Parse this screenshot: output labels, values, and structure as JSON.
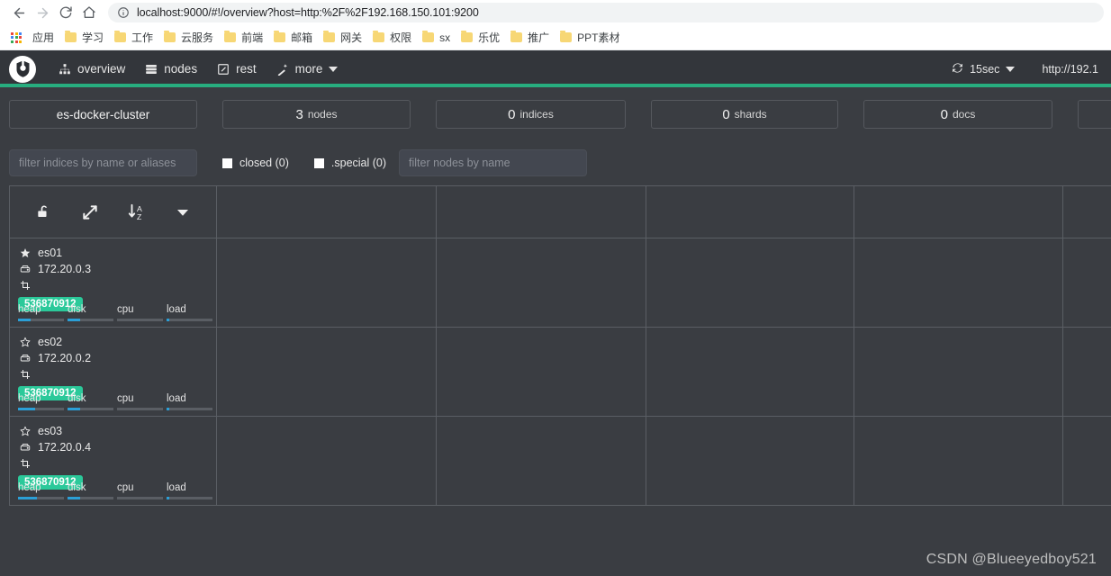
{
  "browser": {
    "back_icon": "back-arrow-icon",
    "forward_icon": "forward-arrow-icon",
    "reload_icon": "reload-icon",
    "home_icon": "home-icon",
    "url_host": "localhost:9000",
    "url_rest": "/#!/overview?host=http:%2F%2F192.168.150.101:9200",
    "url_full": "localhost:9000/#!/overview?host=http:%2F%2F192.168.150.101:9200",
    "apps_label": "应用",
    "bookmarks": [
      {
        "label": "学习"
      },
      {
        "label": "工作"
      },
      {
        "label": "云服务"
      },
      {
        "label": "前端"
      },
      {
        "label": "邮箱"
      },
      {
        "label": "网关"
      },
      {
        "label": "权限"
      },
      {
        "label": "sx"
      },
      {
        "label": "乐优"
      },
      {
        "label": "推广"
      },
      {
        "label": "PPT素材"
      }
    ]
  },
  "header": {
    "logo_name": "cerebro-logo",
    "nav": [
      {
        "label": "overview",
        "icon": "sitemap-icon"
      },
      {
        "label": "nodes",
        "icon": "server-icon"
      },
      {
        "label": "rest",
        "icon": "pencil-square-icon"
      },
      {
        "label": "more",
        "icon": "magic-wand-icon",
        "has_caret": true
      }
    ],
    "refresh_interval": "15sec",
    "refresh_icon": "refresh-icon",
    "host": "http://192.1",
    "accent_color": "#27ae7f"
  },
  "stats": [
    {
      "value": "",
      "unit": "",
      "only": "es-docker-cluster",
      "name": "cluster-name-card"
    },
    {
      "value": "3",
      "unit": "nodes",
      "only": "",
      "name": "nodes-count-card"
    },
    {
      "value": "0",
      "unit": "indices",
      "only": "",
      "name": "indices-count-card"
    },
    {
      "value": "0",
      "unit": "shards",
      "only": "",
      "name": "shards-count-card"
    },
    {
      "value": "0",
      "unit": "docs",
      "only": "",
      "name": "docs-count-card"
    },
    {
      "value": "",
      "unit": "",
      "only": "",
      "name": "size-card"
    }
  ],
  "filters": {
    "indices_placeholder": "filter indices by name or aliases",
    "nodes_placeholder": "filter nodes by name",
    "indices_value": "",
    "nodes_value": "",
    "closed_label": "closed (0)",
    "special_label": ".special (0)"
  },
  "toolbar": {
    "buttons": [
      {
        "name": "unlock-icon",
        "label": "unlock"
      },
      {
        "name": "expand-arrows-icon",
        "label": "expand"
      },
      {
        "name": "sort-alpha-icon",
        "label": "sort a-z"
      },
      {
        "name": "chevron-down-icon",
        "label": "more actions"
      }
    ],
    "sort_letters": {
      "top": "A",
      "bottom": "Z"
    }
  },
  "nodes": [
    {
      "name": "es01",
      "master": true,
      "master_icon": "star-filled-icon",
      "ip": "172.20.0.3",
      "ip_icon": "hdd-icon",
      "role_icon": "data-node-icon",
      "heap_badge": "536870912",
      "metrics": [
        {
          "label": "heap",
          "pct": 28
        },
        {
          "label": "disk",
          "pct": 28
        },
        {
          "label": "cpu",
          "pct": 0
        },
        {
          "label": "load",
          "pct": 4
        }
      ]
    },
    {
      "name": "es02",
      "master": false,
      "master_icon": "star-outline-icon",
      "ip": "172.20.0.2",
      "ip_icon": "hdd-icon",
      "role_icon": "data-node-icon",
      "heap_badge": "536870912",
      "metrics": [
        {
          "label": "heap",
          "pct": 38
        },
        {
          "label": "disk",
          "pct": 28
        },
        {
          "label": "cpu",
          "pct": 0
        },
        {
          "label": "load",
          "pct": 4
        }
      ]
    },
    {
      "name": "es03",
      "master": false,
      "master_icon": "star-outline-icon",
      "ip": "172.20.0.4",
      "ip_icon": "hdd-icon",
      "role_icon": "data-node-icon",
      "heap_badge": "536870912",
      "metrics": [
        {
          "label": "heap",
          "pct": 42
        },
        {
          "label": "disk",
          "pct": 28
        },
        {
          "label": "cpu",
          "pct": 0
        },
        {
          "label": "load",
          "pct": 4
        }
      ]
    }
  ],
  "watermark": "CSDN @Blueeyedboy521",
  "colors": {
    "accent_green": "#27ae7f",
    "badge_green": "#2bc99a",
    "metric_blue": "#2b9fd6",
    "panel_bg": "#3a3d42",
    "header_bg": "#33363b"
  }
}
